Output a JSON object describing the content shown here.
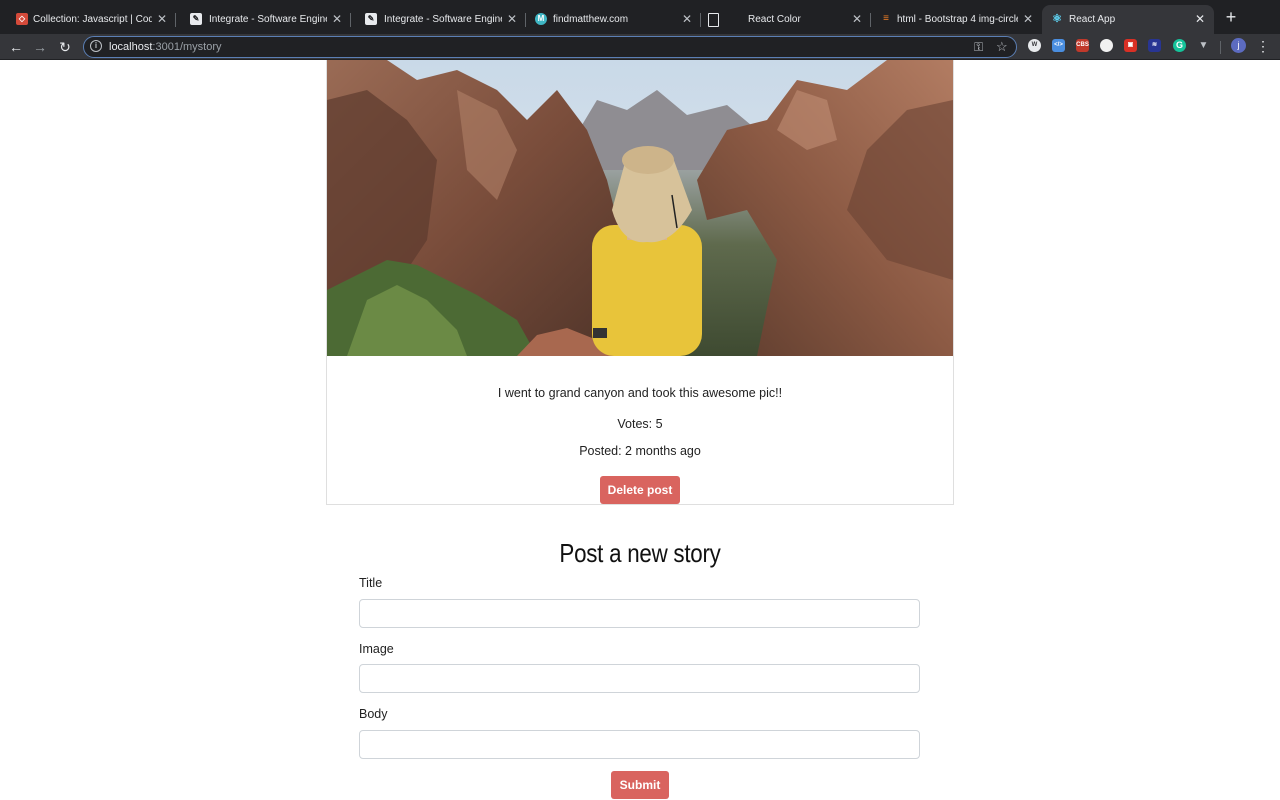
{
  "browser": {
    "tabs": [
      {
        "title": "Collection: Javascript | Code",
        "favicon": "codepen-icon",
        "color": "#d44a3a"
      },
      {
        "title": "Integrate - Software Engineer",
        "favicon": "pencil-icon",
        "color": "#e8eaed"
      },
      {
        "title": "Integrate - Software Engineer",
        "favicon": "pencil-icon",
        "color": "#e8eaed"
      },
      {
        "title": "findmatthew.com",
        "favicon": "m-logo-icon",
        "color": "#3fb6c4"
      },
      {
        "title": "React Color",
        "favicon": "page-icon",
        "color": "#e8eaed"
      },
      {
        "title": "html - Bootstrap 4 img-circle",
        "favicon": "stackoverflow-icon",
        "color": "#f48024"
      },
      {
        "title": "React App",
        "favicon": "react-icon",
        "color": "#61dafb"
      }
    ],
    "url_host": "localhost",
    "url_rest": ":3001/mystory",
    "avatar_letter": "j"
  },
  "story": {
    "caption": "I went to grand canyon and took this awesome pic!!",
    "votes": "Votes: 5",
    "posted": "Posted: 2 months ago",
    "delete_label": "Delete post"
  },
  "form": {
    "heading": "Post a new story",
    "title_label": "Title",
    "image_label": "Image",
    "body_label": "Body",
    "submit_label": "Submit"
  }
}
